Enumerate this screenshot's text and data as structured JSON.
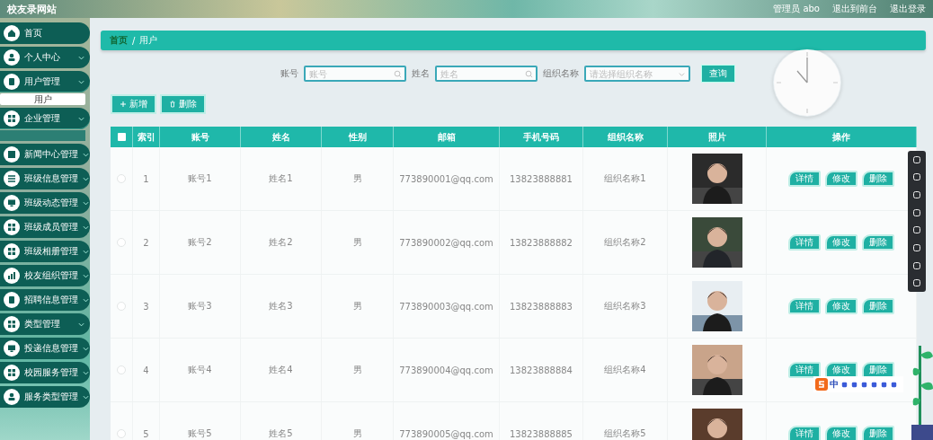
{
  "site_title": "校友录网站",
  "header_links": [
    "管理员 abo",
    "退出到前台",
    "退出登录"
  ],
  "sidebar": {
    "items": [
      {
        "label": "首页",
        "kind": "link",
        "expanded": false
      },
      {
        "label": "个人中心",
        "kind": "menu",
        "expanded": false
      },
      {
        "label": "用户管理",
        "kind": "menu",
        "expanded": true,
        "children": [
          {
            "label": "用户",
            "selected": true
          }
        ]
      },
      {
        "label": "企业管理",
        "kind": "menu",
        "expanded": true
      },
      {
        "label": "新闻中心管理",
        "kind": "menu",
        "expanded": false
      },
      {
        "label": "班级信息管理",
        "kind": "menu",
        "expanded": false
      },
      {
        "label": "班级动态管理",
        "kind": "menu",
        "expanded": false
      },
      {
        "label": "班级成员管理",
        "kind": "menu",
        "expanded": false
      },
      {
        "label": "班级相册管理",
        "kind": "menu",
        "expanded": false
      },
      {
        "label": "校友组织管理",
        "kind": "menu",
        "expanded": false
      },
      {
        "label": "招聘信息管理",
        "kind": "menu",
        "expanded": false
      },
      {
        "label": "类型管理",
        "kind": "menu",
        "expanded": false
      },
      {
        "label": "投递信息管理",
        "kind": "menu",
        "expanded": false
      },
      {
        "label": "校园服务管理",
        "kind": "menu",
        "expanded": false
      },
      {
        "label": "服务类型管理",
        "kind": "menu",
        "expanded": false
      }
    ]
  },
  "breadcrumb": {
    "items": [
      "首页",
      "用户"
    ],
    "separator": "/"
  },
  "search": {
    "fields": [
      {
        "label": "账号",
        "placeholder": "账号",
        "kind": "text"
      },
      {
        "label": "姓名",
        "placeholder": "姓名",
        "kind": "text"
      },
      {
        "label": "组织名称",
        "placeholder": "请选择组织名称",
        "kind": "select"
      }
    ],
    "button": "查询"
  },
  "actions": [
    {
      "label": "新增",
      "kind": "add"
    },
    {
      "label": "删除",
      "kind": "delete"
    }
  ],
  "table": {
    "all_selected": false,
    "columns": [
      "索引",
      "账号",
      "姓名",
      "性别",
      "邮箱",
      "手机号码",
      "组织名称",
      "照片",
      "操作"
    ],
    "rows": [
      {
        "selected": false,
        "cells": [
          "1",
          "账号1",
          "姓名1",
          "男",
          "773890001@qq.com",
          "13823888881",
          "组织名称1"
        ],
        "buttons": [
          "详情",
          "修改",
          "删除"
        ]
      },
      {
        "selected": false,
        "cells": [
          "2",
          "账号2",
          "姓名2",
          "男",
          "773890002@qq.com",
          "13823888882",
          "组织名称2"
        ],
        "buttons": [
          "详情",
          "修改",
          "删除"
        ]
      },
      {
        "selected": false,
        "cells": [
          "3",
          "账号3",
          "姓名3",
          "男",
          "773890003@qq.com",
          "13823888883",
          "组织名称3"
        ],
        "buttons": [
          "详情",
          "修改",
          "删除"
        ]
      },
      {
        "selected": false,
        "cells": [
          "4",
          "账号4",
          "姓名4",
          "男",
          "773890004@qq.com",
          "13823888884",
          "组织名称4"
        ],
        "buttons": [
          "详情",
          "修改",
          "删除"
        ]
      },
      {
        "selected": false,
        "cells": [
          "5",
          "账号5",
          "姓名5",
          "男",
          "773890005@qq.com",
          "13823888885",
          "组织名称5"
        ],
        "buttons": [
          "详情",
          "修改",
          "删除"
        ]
      }
    ]
  },
  "ime_bar": {
    "mode": "中"
  }
}
